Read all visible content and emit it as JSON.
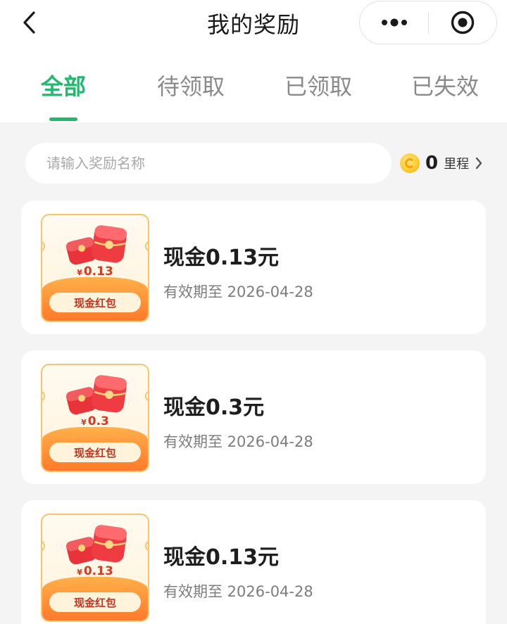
{
  "header": {
    "title": "我的奖励",
    "back_icon": "chevron-left-icon",
    "more_icon": "more-dots-icon",
    "close_icon": "target-close-icon"
  },
  "tabs": [
    {
      "label": "全部",
      "active": true
    },
    {
      "label": "待领取",
      "active": false
    },
    {
      "label": "已领取",
      "active": false
    },
    {
      "label": "已失效",
      "active": false
    }
  ],
  "colors": {
    "accent": "#21b86c",
    "card_orange": "#ff7a2a",
    "red_envelope": "#e8333a"
  },
  "search": {
    "placeholder": "请输入奖励名称",
    "value": ""
  },
  "points": {
    "value": "0",
    "unit": "里程",
    "icon": "coin-icon"
  },
  "rewards": [
    {
      "title": "现金0.13元",
      "expiry": "有效期至 2026-04-28",
      "badge_currency": "¥",
      "badge_value": "0.13",
      "badge_label": "现金红包"
    },
    {
      "title": "现金0.3元",
      "expiry": "有效期至 2026-04-28",
      "badge_currency": "¥",
      "badge_value": "0.3",
      "badge_label": "现金红包"
    },
    {
      "title": "现金0.13元",
      "expiry": "有效期至 2026-04-28",
      "badge_currency": "¥",
      "badge_value": "0.13",
      "badge_label": "现金红包"
    }
  ]
}
